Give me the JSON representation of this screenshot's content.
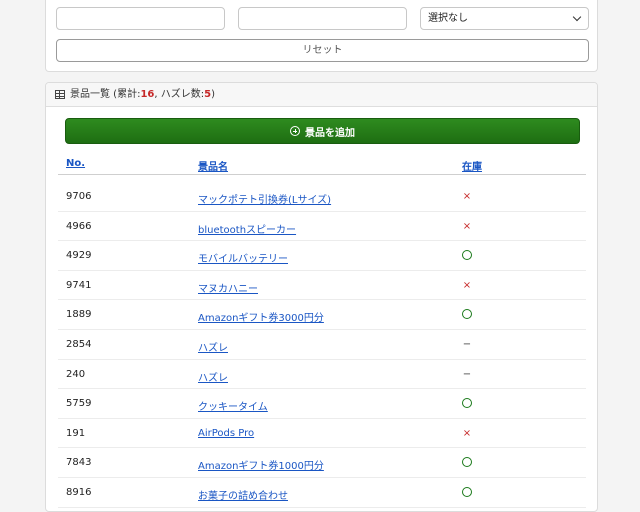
{
  "filters": {
    "field1_value": "",
    "field2_value": "",
    "select_value": "選択なし",
    "reset_label": "リセット"
  },
  "list": {
    "header_title": "景品一覧 (累計: ",
    "total_count": "16",
    "sep": ", ハズレ数: ",
    "miss_count": "5",
    "close_paren": ")",
    "add_label": "景品を追加",
    "columns": [
      "No.",
      "景品名",
      "在庫"
    ],
    "rows": [
      {
        "no": "9706",
        "name": "マックポテト引換券(Lサイズ)",
        "stock": "x"
      },
      {
        "no": "4966",
        "name": "bluetoothスピーカー",
        "stock": "x"
      },
      {
        "no": "4929",
        "name": "モバイルバッテリー",
        "stock": "o"
      },
      {
        "no": "9741",
        "name": "マヌカハニー",
        "stock": "x"
      },
      {
        "no": "1889",
        "name": "Amazonギフト券3000円分",
        "stock": "o"
      },
      {
        "no": "2854",
        "name": "ハズレ",
        "stock": "-"
      },
      {
        "no": "240",
        "name": "ハズレ",
        "stock": "-"
      },
      {
        "no": "5759",
        "name": "クッキータイム",
        "stock": "o"
      },
      {
        "no": "191",
        "name": "AirPods Pro",
        "stock": "x"
      },
      {
        "no": "7843",
        "name": "Amazonギフト券1000円分",
        "stock": "o"
      },
      {
        "no": "8916",
        "name": "お菓子の詰め合わせ",
        "stock": "o"
      }
    ]
  },
  "icons": {
    "table": "table-icon",
    "add": "plus-circle-icon",
    "select": "chevron-down-icon"
  },
  "colors": {
    "accent_green": "#1e6e12",
    "link_blue": "#1a56c4",
    "count_red": "#c62828"
  }
}
